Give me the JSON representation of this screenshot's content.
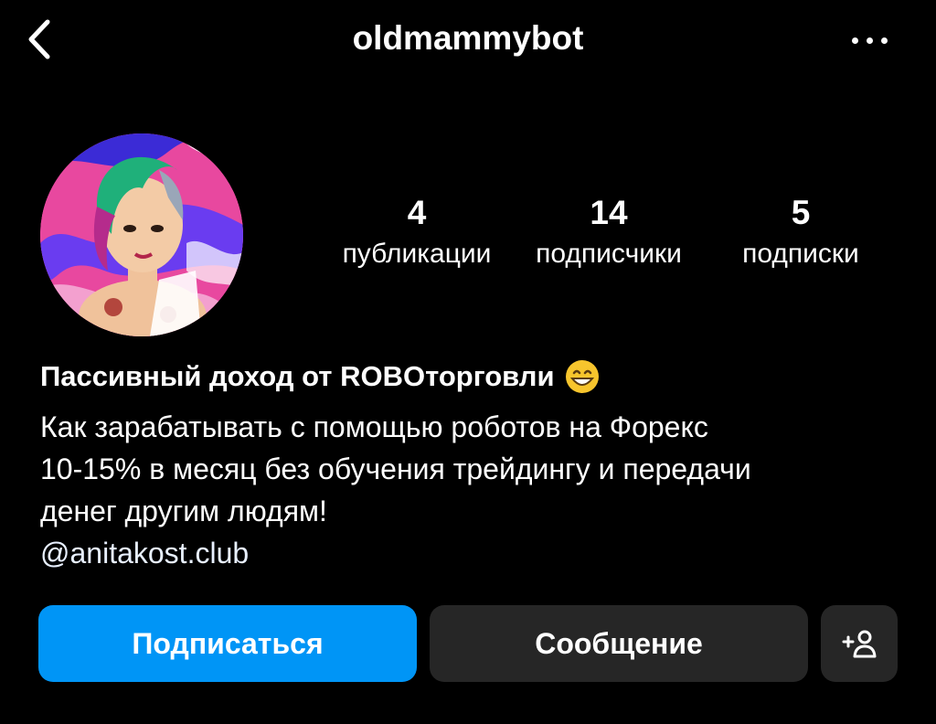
{
  "header": {
    "username": "oldmammybot",
    "back_icon": "chevron-left-icon",
    "more_icon": "more-horizontal-icon"
  },
  "stats": {
    "posts": {
      "count": "4",
      "label": "публикации"
    },
    "followers": {
      "count": "14",
      "label": "подписчики"
    },
    "following": {
      "count": "5",
      "label": "подписки"
    }
  },
  "bio": {
    "title": "Пассивный доход от ROBOторговли",
    "title_emoji": "grinning-face-emoji",
    "lines": [
      "Как зарабатывать с помощью роботов на Форекс",
      "10-15% в месяц без обучения трейдингу и передачи",
      "денег другим людям!"
    ],
    "link": "@anitakost.club"
  },
  "actions": {
    "follow_label": "Подписаться",
    "message_label": "Сообщение",
    "suggest_icon": "add-person-icon",
    "suggest_text": "+"
  },
  "colors": {
    "background": "#000000",
    "follow_button": "#0095f6",
    "secondary_button": "#262626",
    "text": "#ffffff"
  }
}
